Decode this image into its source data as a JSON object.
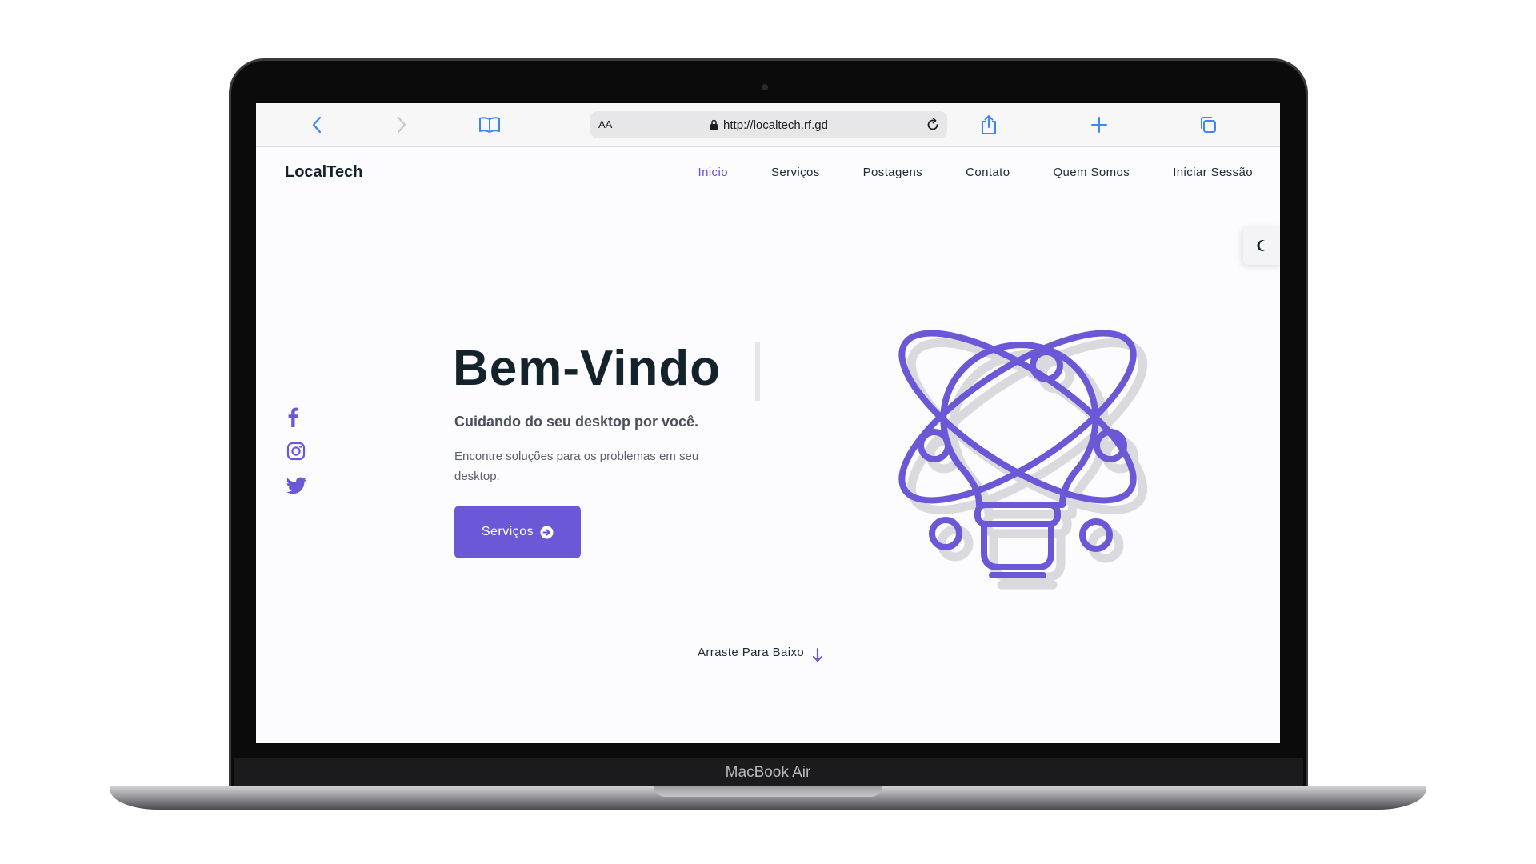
{
  "device": {
    "model_label": "MacBook Air"
  },
  "browser": {
    "text_size_label": "AA",
    "url": "http://localtech.rf.gd",
    "icons": {
      "back": "chevron-left-icon",
      "forward": "chevron-right-icon",
      "bookmarks": "book-icon",
      "lock": "lock-icon",
      "reload": "reload-icon",
      "share": "share-icon",
      "new_tab": "plus-icon",
      "tabs": "tabs-icon"
    },
    "accent_color": "#3a87f5"
  },
  "site": {
    "logo": "LocalTech",
    "nav": [
      {
        "label": "Inicio",
        "active": true
      },
      {
        "label": "Serviços",
        "active": false
      },
      {
        "label": "Postagens",
        "active": false
      },
      {
        "label": "Contato",
        "active": false
      },
      {
        "label": "Quem Somos",
        "active": false
      },
      {
        "label": "Iniciar Sessão",
        "active": false
      }
    ],
    "theme_toggle_icon": "moon-icon",
    "social_icons": [
      "facebook-icon",
      "instagram-icon",
      "twitter-icon"
    ],
    "hero": {
      "title": "Bem-Vindo",
      "subtitle": "Cuidando do seu desktop por você.",
      "description": "Encontre soluções para os problemas em seu desktop.",
      "cta_label": "Serviços",
      "cta_icon": "arrow-circle-right-icon",
      "illustration": "lightbulb-orbit-icon"
    },
    "scroll_hint": "Arraste Para Baixo",
    "scroll_icon": "arrow-down-icon",
    "brand_color": "#6a58d6",
    "text_color": "#14232b"
  }
}
